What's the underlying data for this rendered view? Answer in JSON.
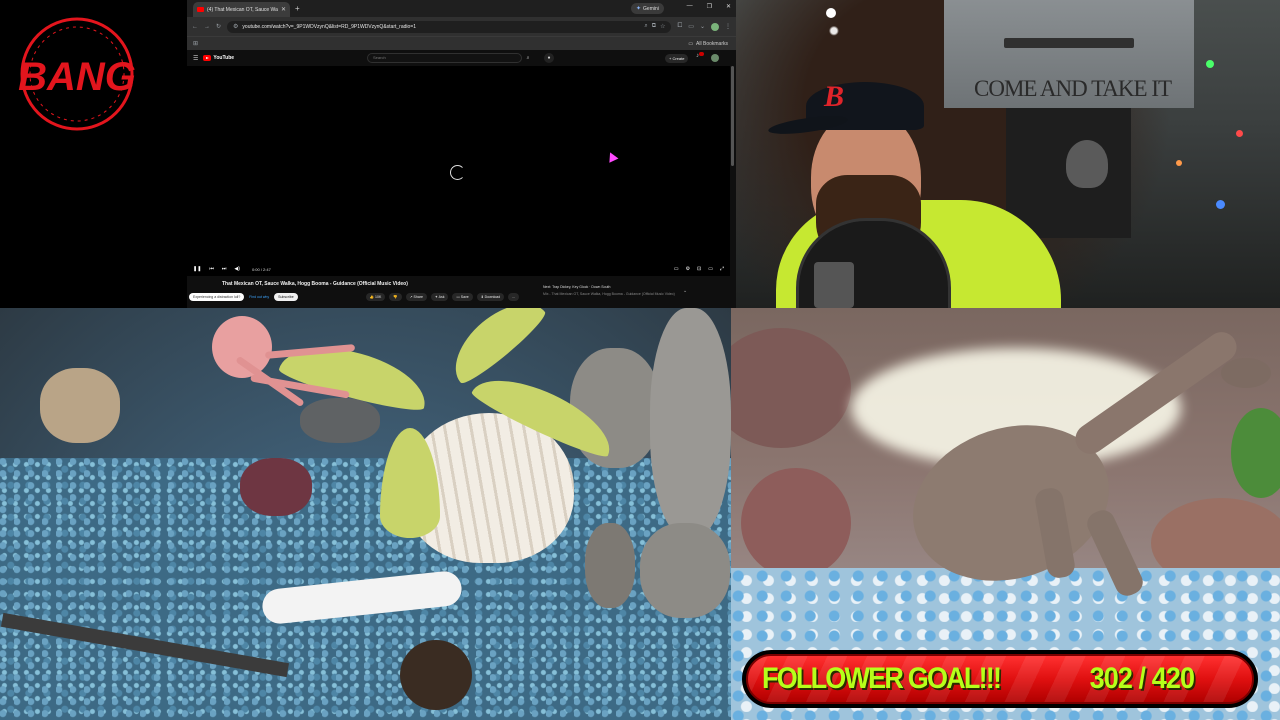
{
  "logo": {
    "text": "BANG",
    "color": "#e3151d"
  },
  "browser": {
    "tab_title": "(4) That Mexican OT, Sauce Wa...",
    "gemini_label": "Gemini",
    "url": "youtube.com/watch?v=_9P1WDVzynQ&list=RD_9P1WDVzynQ&start_radio=1",
    "all_bookmarks": "All Bookmarks",
    "youtube": {
      "brand": "YouTube",
      "search_placeholder": "Search",
      "create_label": "+ Create",
      "time": "0:00 / 2:47",
      "video_title": "That Mexican OT, Sauce Walka, Hogg Booma - Guidance (Official Music Video)",
      "promo_text": "Experiencing a distraction lull?",
      "promo_link": "Find out why",
      "subscribe_label": "Subscribe",
      "like_count": "10K",
      "share_label": "Share",
      "ask_label": "Ask",
      "save_label": "Save",
      "download_label": "Download",
      "more_label": "...",
      "up_next": "Next: Trap Dickey, Key Glock · Down South",
      "up_next_sub": "Mix - That Mexican OT, Sauce Walka, Hogg Booma - Guidance (Official Music Video)"
    }
  },
  "webcam": {
    "flag_text": "COME AND TAKE IT",
    "hat_letter": "B"
  },
  "overlay": {
    "goal_label": "FOLLOWER GOAL!!!",
    "goal_count": "302 / 420",
    "goal_current": 302,
    "goal_target": 420,
    "accent_green": "#b6ff1a",
    "accent_red": "#e01010"
  }
}
